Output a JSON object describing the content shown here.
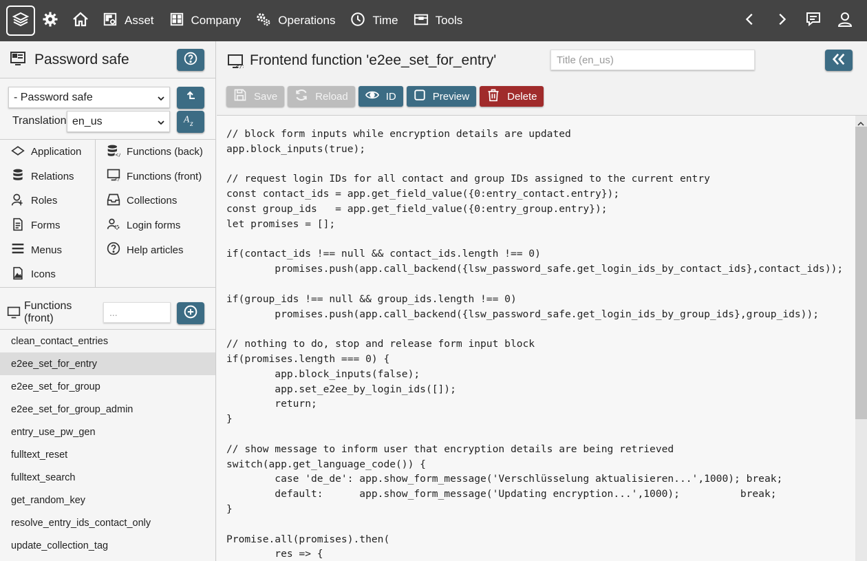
{
  "topbar": {
    "items": [
      {
        "label": "Asset",
        "icon": "asset-icon"
      },
      {
        "label": "Company",
        "icon": "company-icon"
      },
      {
        "label": "Operations",
        "icon": "operations-icon"
      },
      {
        "label": "Time",
        "icon": "clock-icon"
      },
      {
        "label": "Tools",
        "icon": "toolbox-icon"
      }
    ]
  },
  "left": {
    "title": "Password safe",
    "app_select": "- Password safe",
    "translation_label": "Translation",
    "translation_select": "en_us",
    "nav_col1": [
      {
        "label": "Application",
        "icon": "diamond-icon"
      },
      {
        "label": "Relations",
        "icon": "database-icon"
      },
      {
        "label": "Roles",
        "icon": "roles-icon"
      },
      {
        "label": "Forms",
        "icon": "form-icon"
      },
      {
        "label": "Menus",
        "icon": "menu-icon"
      },
      {
        "label": "Icons",
        "icon": "image-icon"
      }
    ],
    "nav_col2": [
      {
        "label": "Functions (back)",
        "icon": "server-function-icon"
      },
      {
        "label": "Functions (front)",
        "icon": "monitor-function-icon"
      },
      {
        "label": "Collections",
        "icon": "inbox-icon"
      },
      {
        "label": "Login forms",
        "icon": "login-form-icon"
      },
      {
        "label": "Help articles",
        "icon": "question-icon"
      }
    ],
    "functions_label_1": "Functions",
    "functions_label_2": "(front)",
    "filter_placeholder": "...",
    "functions": [
      "clean_contact_entries",
      "e2ee_set_for_entry",
      "e2ee_set_for_group",
      "e2ee_set_for_group_admin",
      "entry_use_pw_gen",
      "fulltext_reset",
      "fulltext_search",
      "get_random_key",
      "resolve_entry_ids_contact_only",
      "update_collection_tag"
    ],
    "active_function": "e2ee_set_for_entry"
  },
  "main": {
    "title": "Frontend function 'e2ee_set_for_entry'",
    "title_input_placeholder": "Title (en_us)",
    "toolbar": {
      "save": "Save",
      "reload": "Reload",
      "id": "ID",
      "preview": "Preview",
      "delete": "Delete"
    },
    "code_lines": [
      "// block form inputs while encryption details are updated",
      "app.block_inputs(true);",
      "",
      "// request login IDs for all contact and group IDs assigned to the current entry",
      "const contact_ids = app.get_field_value({0:entry_contact.entry});",
      "const group_ids   = app.get_field_value({0:entry_group.entry});",
      "let promises = [];",
      "",
      "if(contact_ids !== null && contact_ids.length !== 0)",
      "\tpromises.push(app.call_backend({lsw_password_safe.get_login_ids_by_contact_ids},contact_ids));",
      "",
      "if(group_ids !== null && group_ids.length !== 0)",
      "\tpromises.push(app.call_backend({lsw_password_safe.get_login_ids_by_group_ids},group_ids));",
      "",
      "// nothing to do, stop and release form input block",
      "if(promises.length === 0) {",
      "\tapp.block_inputs(false);",
      "\tapp.set_e2ee_by_login_ids([]);",
      "\treturn;",
      "}",
      "",
      "// show message to inform user that encryption details are being retrieved",
      "switch(app.get_language_code()) {",
      "\tcase 'de_de': app.show_form_message('Verschlüsselung aktualisieren...',1000); break;",
      "\tdefault:      app.show_form_message('Updating encryption...',1000);          break;",
      "}",
      "",
      "Promise.all(promises).then(",
      "\tres => {"
    ]
  }
}
